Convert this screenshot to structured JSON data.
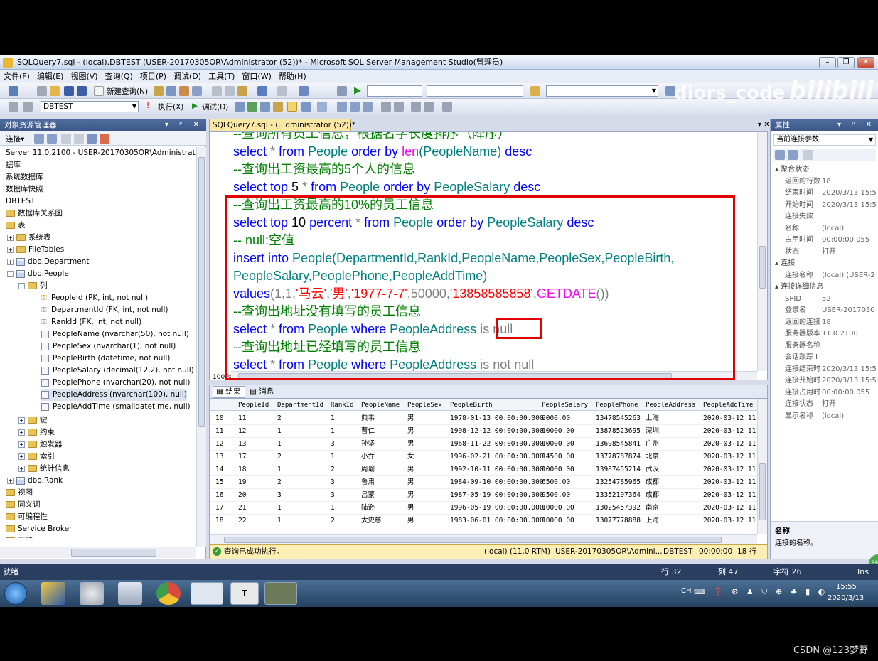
{
  "window": {
    "title": "SQLQuery7.sql - (local).DBTEST (USER-20170305OR\\Administrator (52))* - Microsoft SQL Server Management Studio(管理员)",
    "minimize": "–",
    "restore": "❐",
    "close": "✕"
  },
  "menu": [
    "文件(F)",
    "编辑(E)",
    "视图(V)",
    "查询(Q)",
    "项目(P)",
    "调试(D)",
    "工具(T)",
    "窗口(W)",
    "帮助(H)"
  ],
  "toolbar": {
    "new_query": "新建查询(N)",
    "database": "DBTEST",
    "execute": "执行(X)",
    "debug": "调试(D)"
  },
  "watermark": {
    "text1": "diors_code",
    "text2": "bilibili"
  },
  "object_explorer": {
    "title": "对象资源管理器",
    "pin": "▾ ᵖ ✕",
    "connect": "连接▾",
    "server": "Server 11.0.2100 - USER-20170305OR\\Administrator)",
    "nodes": [
      "据库",
      "系统数据库",
      "数据库快照",
      "DBTEST",
      "数据库关系图",
      "表",
      "系统表",
      "FileTables",
      "dbo.Department",
      "dbo.People",
      "列",
      "PeopleId (PK, int, not null)",
      "DepartmentId (FK, int, not null)",
      "RankId (FK, int, not null)",
      "PeopleName (nvarchar(50), not null)",
      "PeopleSex (nvarchar(1), not null)",
      "PeopleBirth (datetime, not null)",
      "PeopleSalary (decimal(12,2), not null)",
      "PeoplePhone (nvarchar(20), not null)",
      "PeopleAddress (nvarchar(100), null)",
      "PeopleAddTime (smalldatetime, null)",
      "键",
      "约束",
      "触发器",
      "索引",
      "统计信息",
      "dbo.Rank",
      "视图",
      "同义词",
      "可编程性",
      "Service Broker",
      "存储"
    ]
  },
  "editor": {
    "tab": "SQLQuery7.sql - (...dministrator (52))*",
    "zoom": "100 %",
    "lines": {
      "l0": "--查询所有员工信息，根据名字长度排序（降序）",
      "l1_select": "select",
      "l1_star": " * ",
      "l1_from": "from ",
      "l1_tbl": "People ",
      "l1_order": "order by ",
      "l1_fn": "len",
      "l1_arg": "(PeopleName) ",
      "l1_desc": "desc",
      "l2": "--查询出工资最高的5个人的信息",
      "l3_select": "select  top ",
      "l3_n": "5",
      "l3_star": " * ",
      "l3_from": "from ",
      "l3_tbl": "People ",
      "l3_order": "order by ",
      "l3_col": "PeopleSalary ",
      "l3_desc": "desc",
      "l4": "--查询出工资最高的10%的员工信息",
      "l5_select": "select  top ",
      "l5_n": "10 ",
      "l5_pct": "percent",
      "l5_star": " * ",
      "l5_from": "from ",
      "l5_tbl": "People ",
      "l5_order": "order by ",
      "l5_col": "PeopleSalary ",
      "l5_desc": "desc",
      "l6": "-- null:空值",
      "l7_ins": "insert into ",
      "l7_tbl": "People",
      "l7_cols": "(DepartmentId,RankId,PeopleName,PeopleSex,PeopleBirth,",
      "l8_cols": "PeopleSalary,PeoplePhone,PeopleAddTime)",
      "l9_values": "values",
      "l9_a": "(1,1,",
      "l9_s1": "'马云'",
      "l9_c1": ",",
      "l9_s2": "'男'",
      "l9_c2": ",",
      "l9_s3": "'1977-7-7'",
      "l9_c3": ",50000,",
      "l9_s4": "'13858585858'",
      "l9_c4": ",",
      "l9_fn": "GETDATE",
      "l9_end": "())",
      "l10": "--查询出地址没有填写的员工信息",
      "l11_select": "select",
      "l11_star": " * ",
      "l11_from": "from ",
      "l11_tbl": "People ",
      "l11_where": "where ",
      "l11_col": "PeopleAddress ",
      "l11_is": "is null",
      "l12": "--查询出地址已经填写的员工信息",
      "l13_select": "select",
      "l13_star": " * ",
      "l13_from": "from ",
      "l13_tbl": "People ",
      "l13_where": "where ",
      "l13_col": "PeopleAddress ",
      "l13_is": "is not null"
    }
  },
  "results": {
    "tab_results": "结果",
    "tab_messages": "消息",
    "columns": [
      "PeopleId",
      "DepartmentId",
      "RankId",
      "PeopleName",
      "PeopleSex",
      "PeopleBirth",
      "PeopleSalary",
      "PeoplePhone",
      "PeopleAddress",
      "PeopleAddTime"
    ],
    "rows": [
      [
        "10",
        "11",
        "2",
        "1",
        "典韦",
        "男",
        "1978-01-13 00:00:00.000",
        "9000.00",
        "13478545263",
        "上海",
        "2020-03-12 11"
      ],
      [
        "11",
        "12",
        "1",
        "1",
        "曹仁",
        "男",
        "1998-12-12 00:00:00.000",
        "10000.00",
        "13878523695",
        "深圳",
        "2020-03-12 11"
      ],
      [
        "12",
        "13",
        "1",
        "3",
        "孙坚",
        "男",
        "1968-11-22 00:00:00.000",
        "10000.00",
        "13698545841",
        "广州",
        "2020-03-12 11"
      ],
      [
        "13",
        "17",
        "2",
        "1",
        "小乔",
        "女",
        "1996-02-21 00:00:00.000",
        "14500.00",
        "13778787874",
        "北京",
        "2020-03-12 11"
      ],
      [
        "14",
        "18",
        "1",
        "2",
        "周瑜",
        "男",
        "1992-10-11 00:00:00.000",
        "10000.00",
        "13987455214",
        "武汉",
        "2020-03-12 11"
      ],
      [
        "15",
        "19",
        "2",
        "3",
        "鲁肃",
        "男",
        "1984-09-10 00:00:00.000",
        "6500.00",
        "13254785965",
        "成都",
        "2020-03-12 11"
      ],
      [
        "16",
        "20",
        "3",
        "3",
        "吕蒙",
        "男",
        "1987-05-19 00:00:00.000",
        "9500.00",
        "13352197364",
        "成都",
        "2020-03-12 11"
      ],
      [
        "17",
        "21",
        "1",
        "1",
        "陆逊",
        "男",
        "1996-05-19 00:00:00.000",
        "10000.00",
        "13025457392",
        "南京",
        "2020-03-12 11"
      ],
      [
        "18",
        "22",
        "1",
        "2",
        "太史慈",
        "男",
        "1983-06-01 00:00:00.000",
        "10000.00",
        "13077778888",
        "上海",
        "2020-03-12 11"
      ]
    ]
  },
  "query_status": {
    "message": "查询已成功执行。",
    "server": "(local) (11.0 RTM)",
    "user": "USER-20170305OR\\Admini...",
    "db": "DBTEST",
    "time": "00:00:00",
    "rows": "18 行"
  },
  "properties": {
    "title": "属性",
    "object": "当前连接参数",
    "section1": "聚合状态",
    "items1": [
      [
        "返回的行数",
        "18"
      ],
      [
        "结束时间",
        "2020/3/13 15:5"
      ],
      [
        "开始时间",
        "2020/3/13 15:5"
      ],
      [
        "连接失败",
        ""
      ],
      [
        "名称",
        "(local)"
      ],
      [
        "占用时间",
        "00:00:00.055"
      ],
      [
        "状态",
        "打开"
      ]
    ],
    "section2": "连接",
    "items2": [
      [
        "连接名称",
        "(local) (USER-2"
      ]
    ],
    "section3": "连接详细信息",
    "items3": [
      [
        "SPID",
        "52"
      ],
      [
        "登录名",
        "USER-2017030"
      ],
      [
        "返回的连接",
        "18"
      ],
      [
        "服务器版本",
        "11.0.2100"
      ],
      [
        "服务器名称",
        ""
      ],
      [
        "会话跟踪 I",
        ""
      ],
      [
        "连接结束时",
        "2020/3/13 15:5"
      ],
      [
        "连接开始时",
        "2020/3/13 15:5"
      ],
      [
        "连接占用时",
        "00:00:00.055"
      ],
      [
        "连接状态",
        "打开"
      ],
      [
        "显示名称",
        "(local)"
      ]
    ],
    "desc_title": "名称",
    "desc_text": "连接的名称。"
  },
  "statusbar": {
    "ready": "就绪",
    "line": "行 32",
    "col": "列 47",
    "char": "字符 26",
    "ins": "Ins"
  },
  "taskbar": {
    "lang": "CH",
    "time": "15:55",
    "date": "2020/3/13"
  },
  "credit": "CSDN @123梦野"
}
